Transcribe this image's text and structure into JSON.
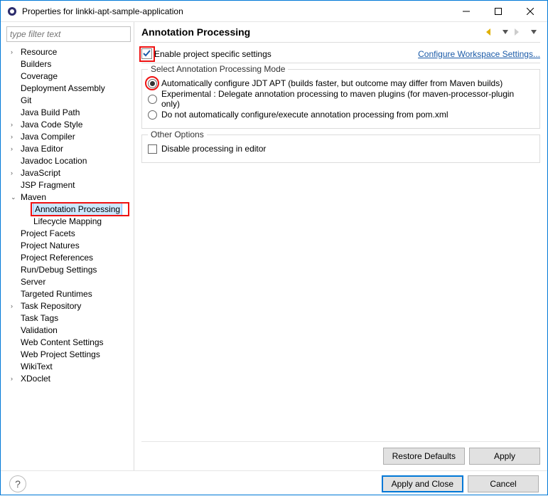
{
  "titlebar": {
    "title": "Properties for linkki-apt-sample-application"
  },
  "filter": {
    "placeholder": "type filter text"
  },
  "tree": {
    "items": [
      {
        "label": "Resource",
        "has_children": true,
        "expanded": false
      },
      {
        "label": "Builders"
      },
      {
        "label": "Coverage"
      },
      {
        "label": "Deployment Assembly"
      },
      {
        "label": "Git"
      },
      {
        "label": "Java Build Path"
      },
      {
        "label": "Java Code Style",
        "has_children": true,
        "expanded": false
      },
      {
        "label": "Java Compiler",
        "has_children": true,
        "expanded": false
      },
      {
        "label": "Java Editor",
        "has_children": true,
        "expanded": false
      },
      {
        "label": "Javadoc Location"
      },
      {
        "label": "JavaScript",
        "has_children": true,
        "expanded": false
      },
      {
        "label": "JSP Fragment"
      },
      {
        "label": "Maven",
        "has_children": true,
        "expanded": true,
        "children": [
          {
            "label": "Annotation Processing",
            "selected": true,
            "highlight": true
          },
          {
            "label": "Lifecycle Mapping"
          }
        ]
      },
      {
        "label": "Project Facets"
      },
      {
        "label": "Project Natures"
      },
      {
        "label": "Project References"
      },
      {
        "label": "Run/Debug Settings"
      },
      {
        "label": "Server"
      },
      {
        "label": "Targeted Runtimes"
      },
      {
        "label": "Task Repository",
        "has_children": true,
        "expanded": false
      },
      {
        "label": "Task Tags"
      },
      {
        "label": "Validation"
      },
      {
        "label": "Web Content Settings"
      },
      {
        "label": "Web Project Settings"
      },
      {
        "label": "WikiText"
      },
      {
        "label": "XDoclet",
        "has_children": true,
        "expanded": false
      }
    ]
  },
  "right": {
    "heading": "Annotation Processing",
    "enable_label": "Enable project specific settings",
    "enable_checked": true,
    "workspace_link": "Configure Workspace Settings...",
    "group1": {
      "legend": "Select Annotation Processing Mode",
      "opt1": "Automatically configure JDT APT (builds faster, but outcome may differ from Maven builds)",
      "opt2": "Experimental : Delegate annotation processing to maven plugins (for maven-processor-plugin only)",
      "opt3": "Do not automatically configure/execute annotation processing from pom.xml",
      "selected": 1
    },
    "group2": {
      "legend": "Other Options",
      "opt1": "Disable processing in editor"
    },
    "restore": "Restore Defaults",
    "apply": "Apply"
  },
  "footer": {
    "apply_close": "Apply and Close",
    "cancel": "Cancel"
  }
}
